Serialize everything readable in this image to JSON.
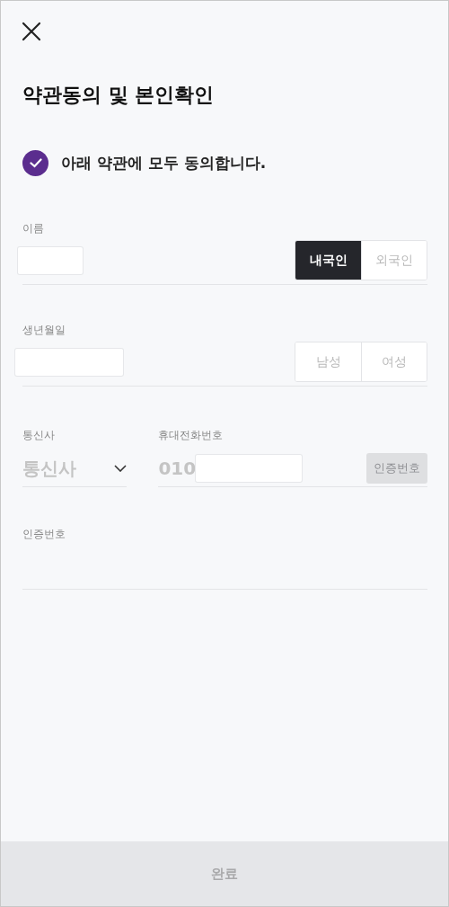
{
  "title": "약관동의 및 본인확인",
  "agree_all": {
    "label": "아래 약관에 모두 동의합니다.",
    "checked": true
  },
  "name_field": {
    "label": "이름",
    "options": [
      {
        "label": "내국인",
        "selected": true
      },
      {
        "label": "외국인",
        "selected": false
      }
    ]
  },
  "birth_field": {
    "label": "생년월일",
    "options": [
      {
        "label": "남성",
        "selected": false
      },
      {
        "label": "여성",
        "selected": false
      }
    ]
  },
  "carrier": {
    "label": "통신사",
    "placeholder": "통신사"
  },
  "phone": {
    "label": "휴대전화번호",
    "prefix": "010",
    "button": {
      "label": "인증번호",
      "disabled": true
    }
  },
  "auth_code": {
    "label": "인증번호"
  },
  "submit": {
    "label": "완료",
    "disabled": true
  }
}
